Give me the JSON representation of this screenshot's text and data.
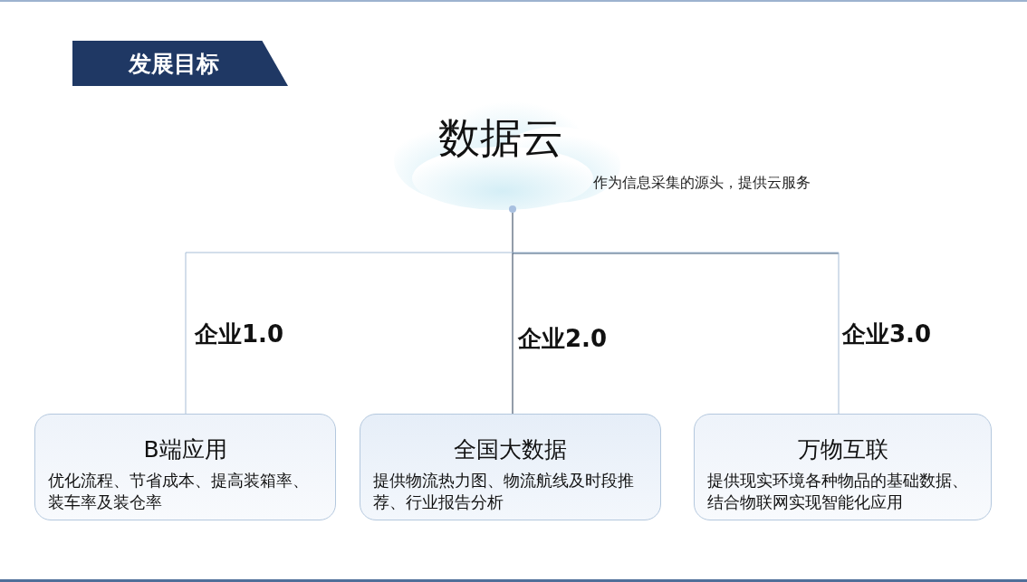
{
  "title": "发展目标",
  "root": {
    "label": "数据云",
    "note": "作为信息采集的源头，提供云服务"
  },
  "branches": [
    {
      "stage": "企业1.0",
      "title": "B端应用",
      "text": "优化流程、节省成本、提高装箱率、装车率及装仓率"
    },
    {
      "stage": "企业2.0",
      "title": "全国大数据",
      "text": "提供物流热力图、物流航线及时段推荐、行业报告分析"
    },
    {
      "stage": "企业3.0",
      "title": "万物互联",
      "text": "提供现实环境各种物品的基础数据、结合物联网实现智能化应用"
    }
  ]
}
